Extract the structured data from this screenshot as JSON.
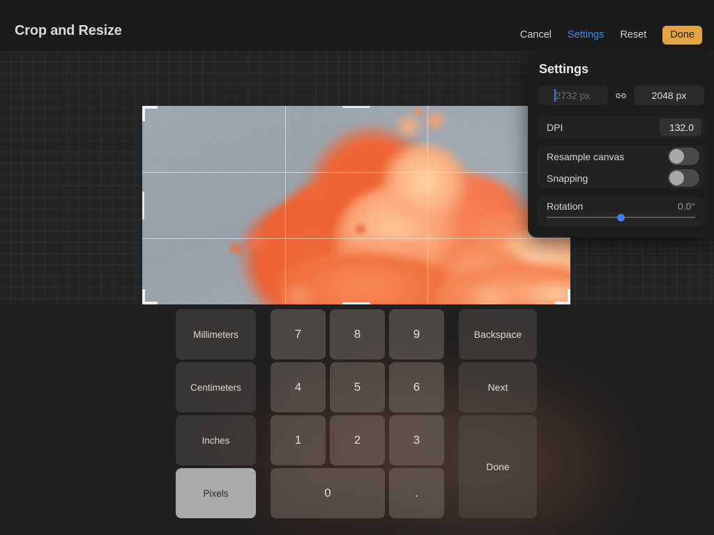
{
  "toolbar": {
    "title": "Crop and Resize",
    "cancel_label": "Cancel",
    "settings_label": "Settings",
    "reset_label": "Reset",
    "done_label": "Done",
    "accent_color": "#3b8bf0",
    "done_bg_color": "#e3a244"
  },
  "settings_popover": {
    "title": "Settings",
    "width_value": "2732 px",
    "width_is_placeholder": true,
    "link_icon": "chain-link-icon",
    "height_value": "2048 px",
    "dpi_label": "DPI",
    "dpi_value": "132.0",
    "resample_label": "Resample canvas",
    "resample_on": false,
    "snapping_label": "Snapping",
    "snapping_on": false,
    "rotation_label": "Rotation",
    "rotation_value": "0.0°",
    "rotation_slider_percent": 50,
    "slider_accent_color": "#3b7ef5"
  },
  "canvas": {
    "artwork_description": "Orange explosion cloud painting on gray-blue canvas",
    "crop_overlay": "rule-of-thirds",
    "handles": [
      "top-left",
      "top-right",
      "bottom-left",
      "bottom-right",
      "top",
      "bottom",
      "left",
      "right"
    ]
  },
  "keypad": {
    "units": [
      {
        "label": "Millimeters",
        "selected": false
      },
      {
        "label": "Centimeters",
        "selected": false
      },
      {
        "label": "Inches",
        "selected": false
      },
      {
        "label": "Pixels",
        "selected": true
      }
    ],
    "digits": [
      "7",
      "8",
      "9",
      "4",
      "5",
      "6",
      "1",
      "2",
      "3"
    ],
    "zero_label": "0",
    "decimal_label": ".",
    "backspace_label": "Backspace",
    "next_label": "Next",
    "done_label": "Done"
  },
  "chart_data": null
}
